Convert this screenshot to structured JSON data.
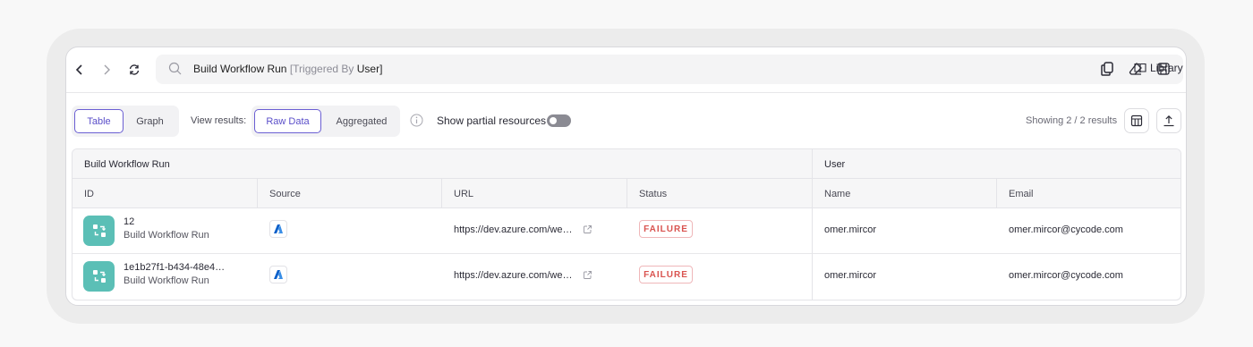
{
  "search": {
    "query_main": "Build Workflow Run",
    "query_muted": " [Triggered By ",
    "query_entity": "User",
    "query_close": "]"
  },
  "header": {
    "library_label": "Library"
  },
  "toolbar": {
    "view_table": "Table",
    "view_graph": "Graph",
    "view_results_label": "View results:",
    "raw_data": "Raw Data",
    "aggregated": "Aggregated",
    "partial_label": "Show partial resources",
    "partial_enabled": false,
    "showing": "Showing 2 / 2 results"
  },
  "table": {
    "groups": [
      "Build Workflow Run",
      "User"
    ],
    "columns": [
      "ID",
      "Source",
      "URL",
      "Status",
      "Name",
      "Email"
    ],
    "rows": [
      {
        "id": "12",
        "type": "Build Workflow Run",
        "source_icon": "azure-devops-icon",
        "url": "https://dev.azure.com/we…",
        "status": "FAILURE",
        "name": "omer.mircor",
        "email": "omer.mircor@cycode.com"
      },
      {
        "id": "1e1b27f1-b434-48e4…",
        "type": "Build Workflow Run",
        "source_icon": "azure-devops-icon",
        "url": "https://dev.azure.com/we…",
        "status": "FAILURE",
        "name": "omer.mircor",
        "email": "omer.mircor@cycode.com"
      }
    ]
  },
  "colors": {
    "accent": "#6b5fd3",
    "icon_bg": "#5bbfb6",
    "failure": "#d9534f"
  }
}
